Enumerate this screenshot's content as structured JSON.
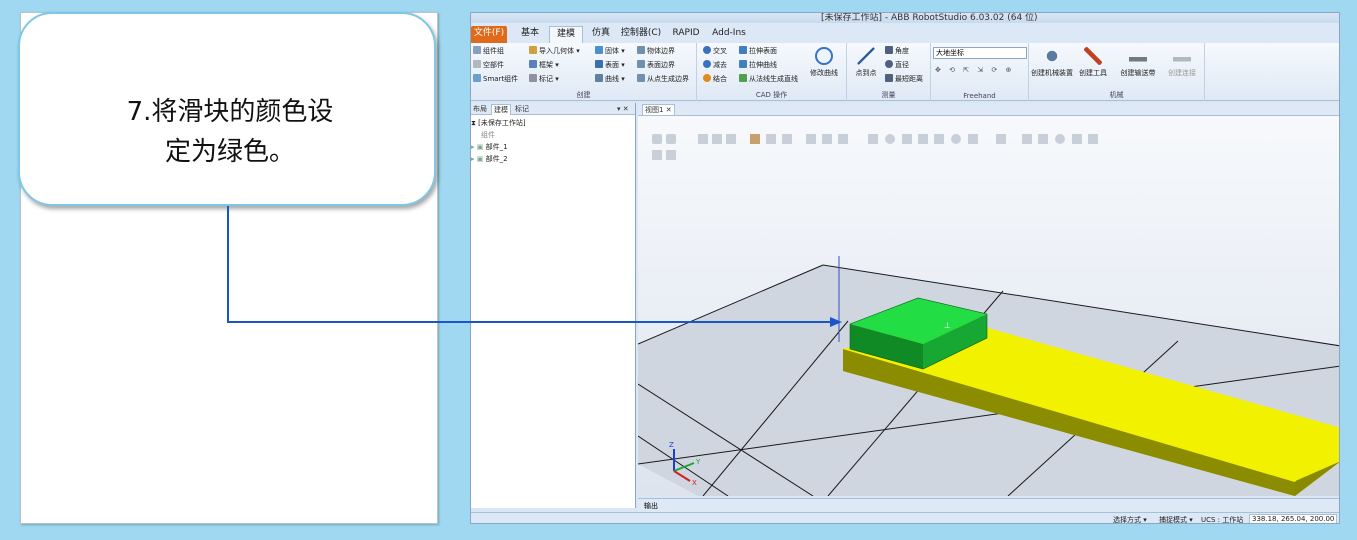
{
  "callout": {
    "text": "7.将滑块的颜色设\n定为绿色。"
  },
  "app": {
    "window_title": "[未保存工作站] - ABB RobotStudio 6.03.02 (64 位)",
    "tabs": [
      {
        "label": "文件(F)"
      },
      {
        "label": "基本"
      },
      {
        "label": "建模"
      },
      {
        "label": "仿真"
      },
      {
        "label": "控制器(C)"
      },
      {
        "label": "RAPID"
      },
      {
        "label": "Add-Ins"
      }
    ],
    "active_tab": "建模",
    "ribbon": {
      "create": {
        "label": "创建",
        "items": [
          "组件组",
          "空部件",
          "Smart组件",
          "导入几何体",
          "框架",
          "标记",
          "固体",
          "表面",
          "曲线",
          "物体边界",
          "表面边界",
          "从点生成边界"
        ]
      },
      "cad": {
        "label": "CAD 操作",
        "items": [
          "交叉",
          "减去",
          "结合",
          "拉伸表面",
          "拉伸曲线",
          "从法线生成直线",
          "修改曲线"
        ]
      },
      "measure": {
        "label": "测量",
        "items": [
          "点到点",
          "角度",
          "直径",
          "最短距离"
        ]
      },
      "freehand": {
        "label": "Freehand",
        "dropdown_value": "大地坐标"
      },
      "mechanism": {
        "label": "机械",
        "items": [
          "创建机械装置",
          "创建工具",
          "创建输送带",
          "创建连接"
        ]
      }
    },
    "side_panel": {
      "tabs": [
        "布局",
        "建模",
        "标记"
      ],
      "tree": [
        "[未保存工作站]",
        "组件",
        "部件_1",
        "部件_2"
      ]
    },
    "view_tab": "视图1",
    "output_tab": "输出",
    "status": {
      "selection_mode": "选择方式 ▾",
      "snap_mode": "捕捉模式 ▾",
      "ucs": "UCS : 工作站",
      "coordinates": "338.18, 265.04, 200.00"
    },
    "colors": {
      "slider": "#22dd44",
      "base_plate": "#f2f200",
      "connector_line": "#1a56c8",
      "file_tab": "#e06a1a"
    }
  }
}
